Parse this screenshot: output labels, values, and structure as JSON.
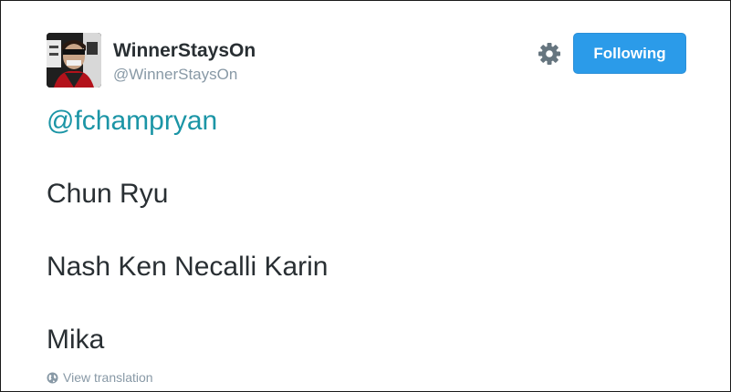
{
  "author": {
    "display_name": "WinnerStaysOn",
    "screen_name": "@WinnerStaysOn",
    "avatar_icon": "profile-photo"
  },
  "actions": {
    "settings_icon": "gear-icon",
    "follow_label": "Following",
    "follow_color": "#2b9be9"
  },
  "tweet": {
    "mention": "@fchampryan",
    "mention_color": "#1b95a6",
    "lines": [
      "Chun Ryu",
      "Nash Ken Necalli Karin",
      "Mika"
    ]
  },
  "footer": {
    "translate_icon": "globe-icon",
    "translate_label": "View translation"
  }
}
